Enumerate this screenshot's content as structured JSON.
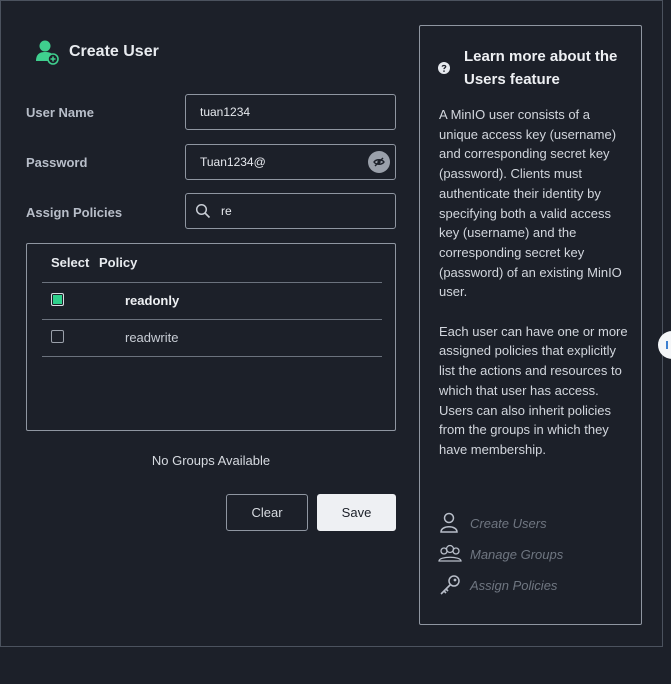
{
  "form": {
    "title": "Create User",
    "user_name": {
      "label": "User Name",
      "value": "tuan1234"
    },
    "password": {
      "label": "Password",
      "value": "Tuan1234@"
    },
    "policies": {
      "label": "Assign Policies",
      "search_value": "re",
      "table": {
        "headers": [
          "Select",
          "Policy"
        ],
        "rows": [
          {
            "name": "readonly",
            "checked": true
          },
          {
            "name": "readwrite",
            "checked": false
          }
        ]
      }
    },
    "groups_message": "No Groups Available",
    "buttons": {
      "clear": "Clear",
      "save": "Save"
    }
  },
  "help": {
    "title": "Learn more about the Users feature",
    "paragraphs": [
      "A MinIO user consists of a unique access key (username) and corresponding secret key (password). Clients must authenticate their identity by specifying both a valid access key (username) and the corresponding secret key (password) of an existing MinIO user.",
      "Each user can have one or more assigned policies that explicitly list the actions and resources to which that user has access. Users can also inherit policies from the groups in which they have membership."
    ],
    "links": [
      {
        "label": "Create Users",
        "icon": "user-icon"
      },
      {
        "label": "Manage Groups",
        "icon": "groups-icon"
      },
      {
        "label": "Assign Policies",
        "icon": "key-icon"
      }
    ]
  },
  "colors": {
    "background": "#1c2029",
    "accent": "#2fd08c",
    "border": "#8f96a1"
  }
}
